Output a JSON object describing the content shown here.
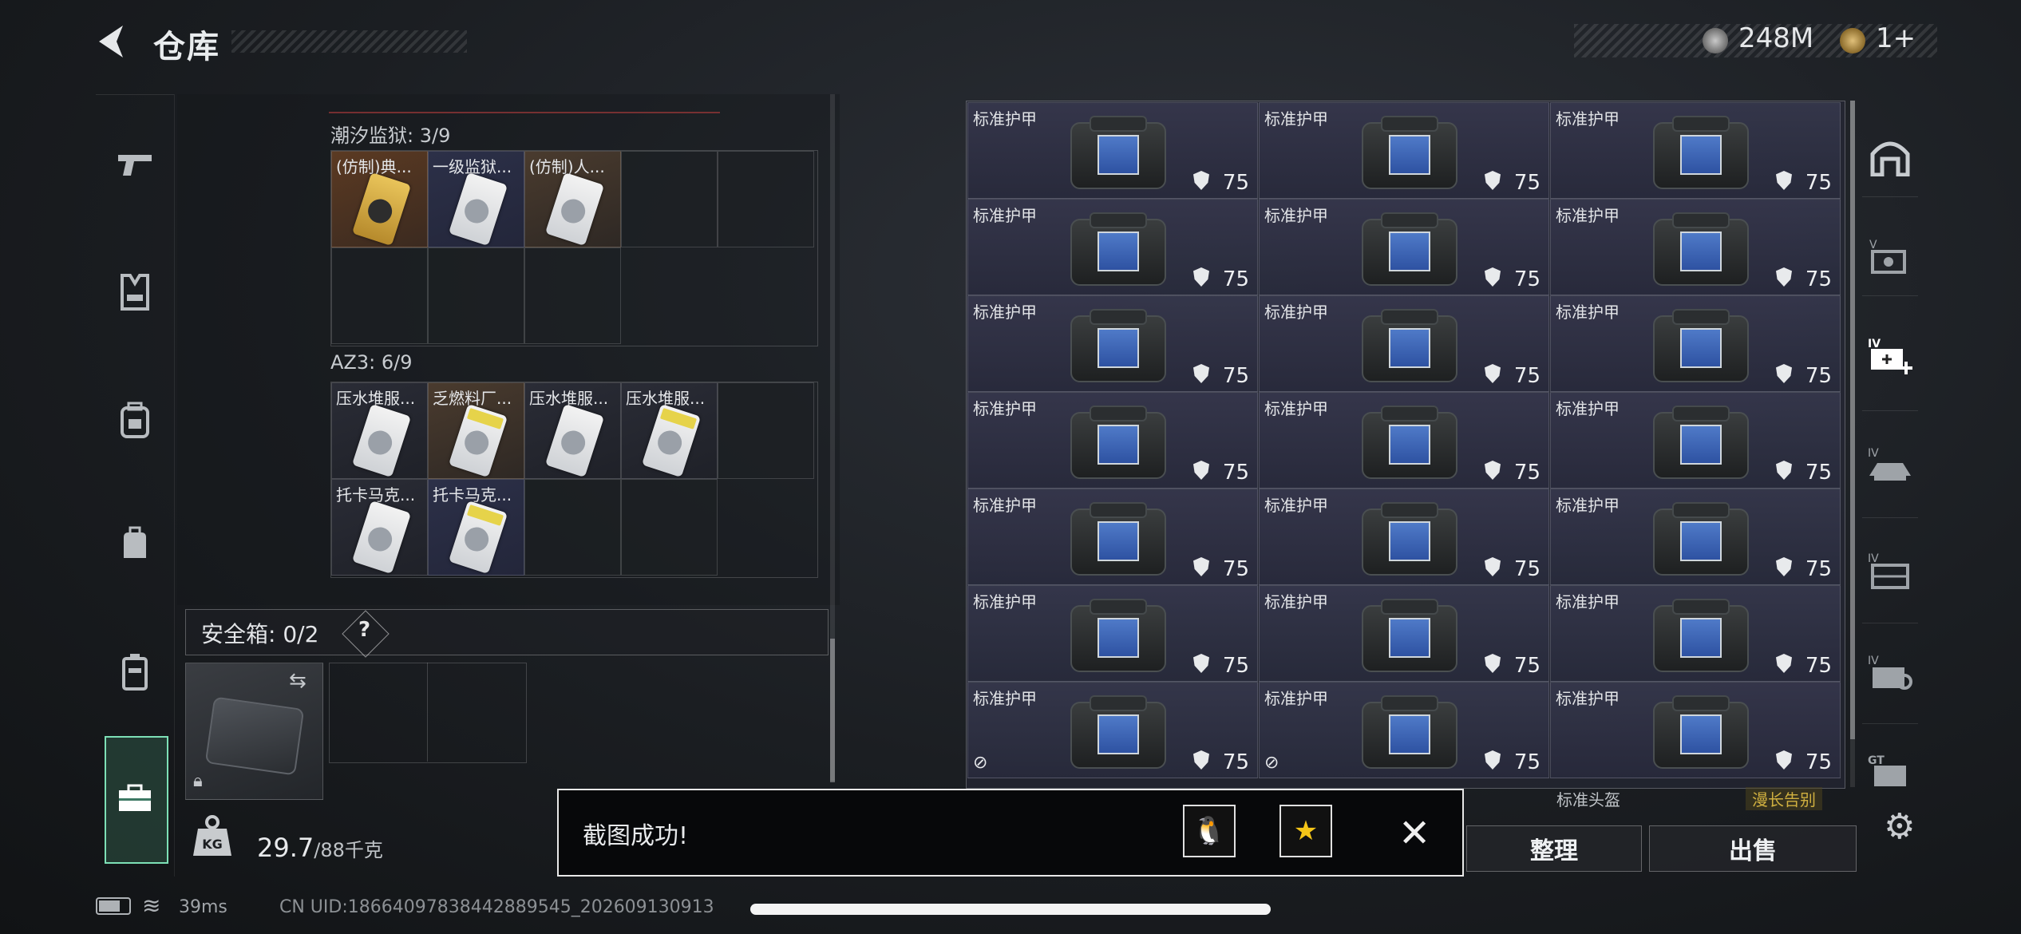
{
  "header": {
    "title": "仓库",
    "currency_1": "248M",
    "currency_2": "1+"
  },
  "left_panel": {
    "section_1": {
      "label": "潮汐监狱: 3/9",
      "items": [
        "(仿制)典...",
        "一级监狱...",
        "(仿制)人..."
      ]
    },
    "section_2": {
      "label": "AZ3: 6/9",
      "items": [
        "压水堆服...",
        "乏燃料厂...",
        "压水堆服...",
        "压水堆服...",
        "托卡马克...",
        "托卡马克..."
      ]
    },
    "safebox": {
      "label": "安全箱: 0/2",
      "help": "?"
    },
    "weight": {
      "current": "29.7",
      "max": "/88千克",
      "icon_text": "KG"
    }
  },
  "stash": {
    "item_name": "标准护甲",
    "durability": "75",
    "rows": 7,
    "partial_row_label": "标准头盔",
    "partial_row_tag": "漫长告别"
  },
  "actions": {
    "organize": "整理",
    "sell": "出售"
  },
  "toast": {
    "text": "截图成功!",
    "qq_glyph": "🐧",
    "qzone_glyph": "★",
    "close_glyph": "✕"
  },
  "status_bar": {
    "ping": "39ms",
    "uid": "CN UID:1866409783844288954​5_202609130913"
  },
  "icons": {
    "left_sidebar": [
      "pistol-icon",
      "vest-icon",
      "backpack-icon",
      "bag-icon",
      "container-icon",
      "toolbox-icon"
    ],
    "right_sidebar": [
      "arch-icon",
      "v-tool-icon",
      "iv-plus-icon",
      "iv-vehicle-icon",
      "iv-shelf-icon",
      "iv-gear-icon",
      "gt-box-icon"
    ]
  },
  "colors": {
    "accent_active": "#7de0b6",
    "toast_border": "#e8e8e8",
    "qzone_star": "#f5c518"
  }
}
